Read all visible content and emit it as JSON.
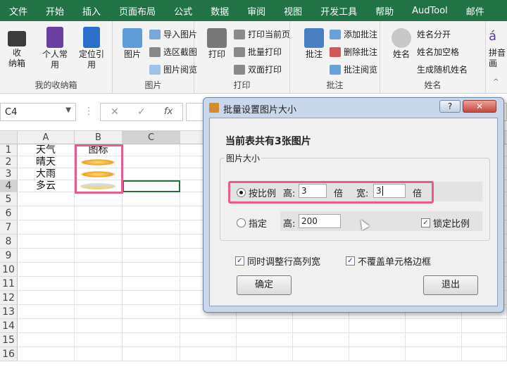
{
  "menu": [
    "文件",
    "开始",
    "插入",
    "页面布局",
    "公式",
    "数据",
    "审阅",
    "视图",
    "开发工具",
    "帮助",
    "AudTool",
    "邮件"
  ],
  "ribbon": {
    "g1": {
      "label": "我的收纳箱",
      "b1": "收\n纳箱",
      "b2": "个人常\n用",
      "b3": "定位引\n用"
    },
    "g2": {
      "label": "图片",
      "big": "图片",
      "s1": "导入图片",
      "s2": "选区截图",
      "s3": "图片阅览"
    },
    "g3": {
      "label": "打印",
      "big": "打印",
      "s1": "打印当前页",
      "s2": "批量打印",
      "s3": "双面打印"
    },
    "g4": {
      "label": "批注",
      "big": "批注",
      "s1": "添加批注",
      "s2": "删除批注",
      "s3": "批注阅览"
    },
    "g5": {
      "label": "姓名",
      "big": "姓名",
      "s1": "姓名分开",
      "s2": "姓名加空格",
      "s3": "生成随机姓名"
    },
    "g6": {
      "label": "拼音",
      "big": "拼音\n画"
    }
  },
  "formula": {
    "namebox": "C4",
    "cancel": "✕",
    "enter": "✓",
    "fx": "fx",
    "value": ""
  },
  "sheet": {
    "columns": [
      "A",
      "B",
      "C"
    ],
    "rows": [
      "1",
      "2",
      "3",
      "4",
      "5",
      "6",
      "7",
      "8",
      "9",
      "10",
      "11",
      "12",
      "13",
      "14",
      "15",
      "16"
    ],
    "a": [
      "天气",
      "晴天",
      "大雨",
      "多云"
    ],
    "b1": "图标"
  },
  "dialog": {
    "title": "批量设置图片大小",
    "help": "?",
    "close": "✕",
    "heading": "当前表共有3张图片",
    "group": "图片大小",
    "ratio_label": "按比例",
    "height_label": "高:",
    "height_value": "3",
    "height_unit": "倍",
    "width_label": "宽:",
    "width_value": "3",
    "width_unit": "倍",
    "specify_label": "指定",
    "specify_height_label": "高:",
    "specify_height_value": "200",
    "lock_label": "锁定比例",
    "adjust_label": "同时调整行高列宽",
    "nocover_label": "不覆盖单元格边框",
    "ok": "确定",
    "exit": "退出"
  },
  "colors": {
    "excel_green": "#217346",
    "highlight": "#e85b8e"
  }
}
